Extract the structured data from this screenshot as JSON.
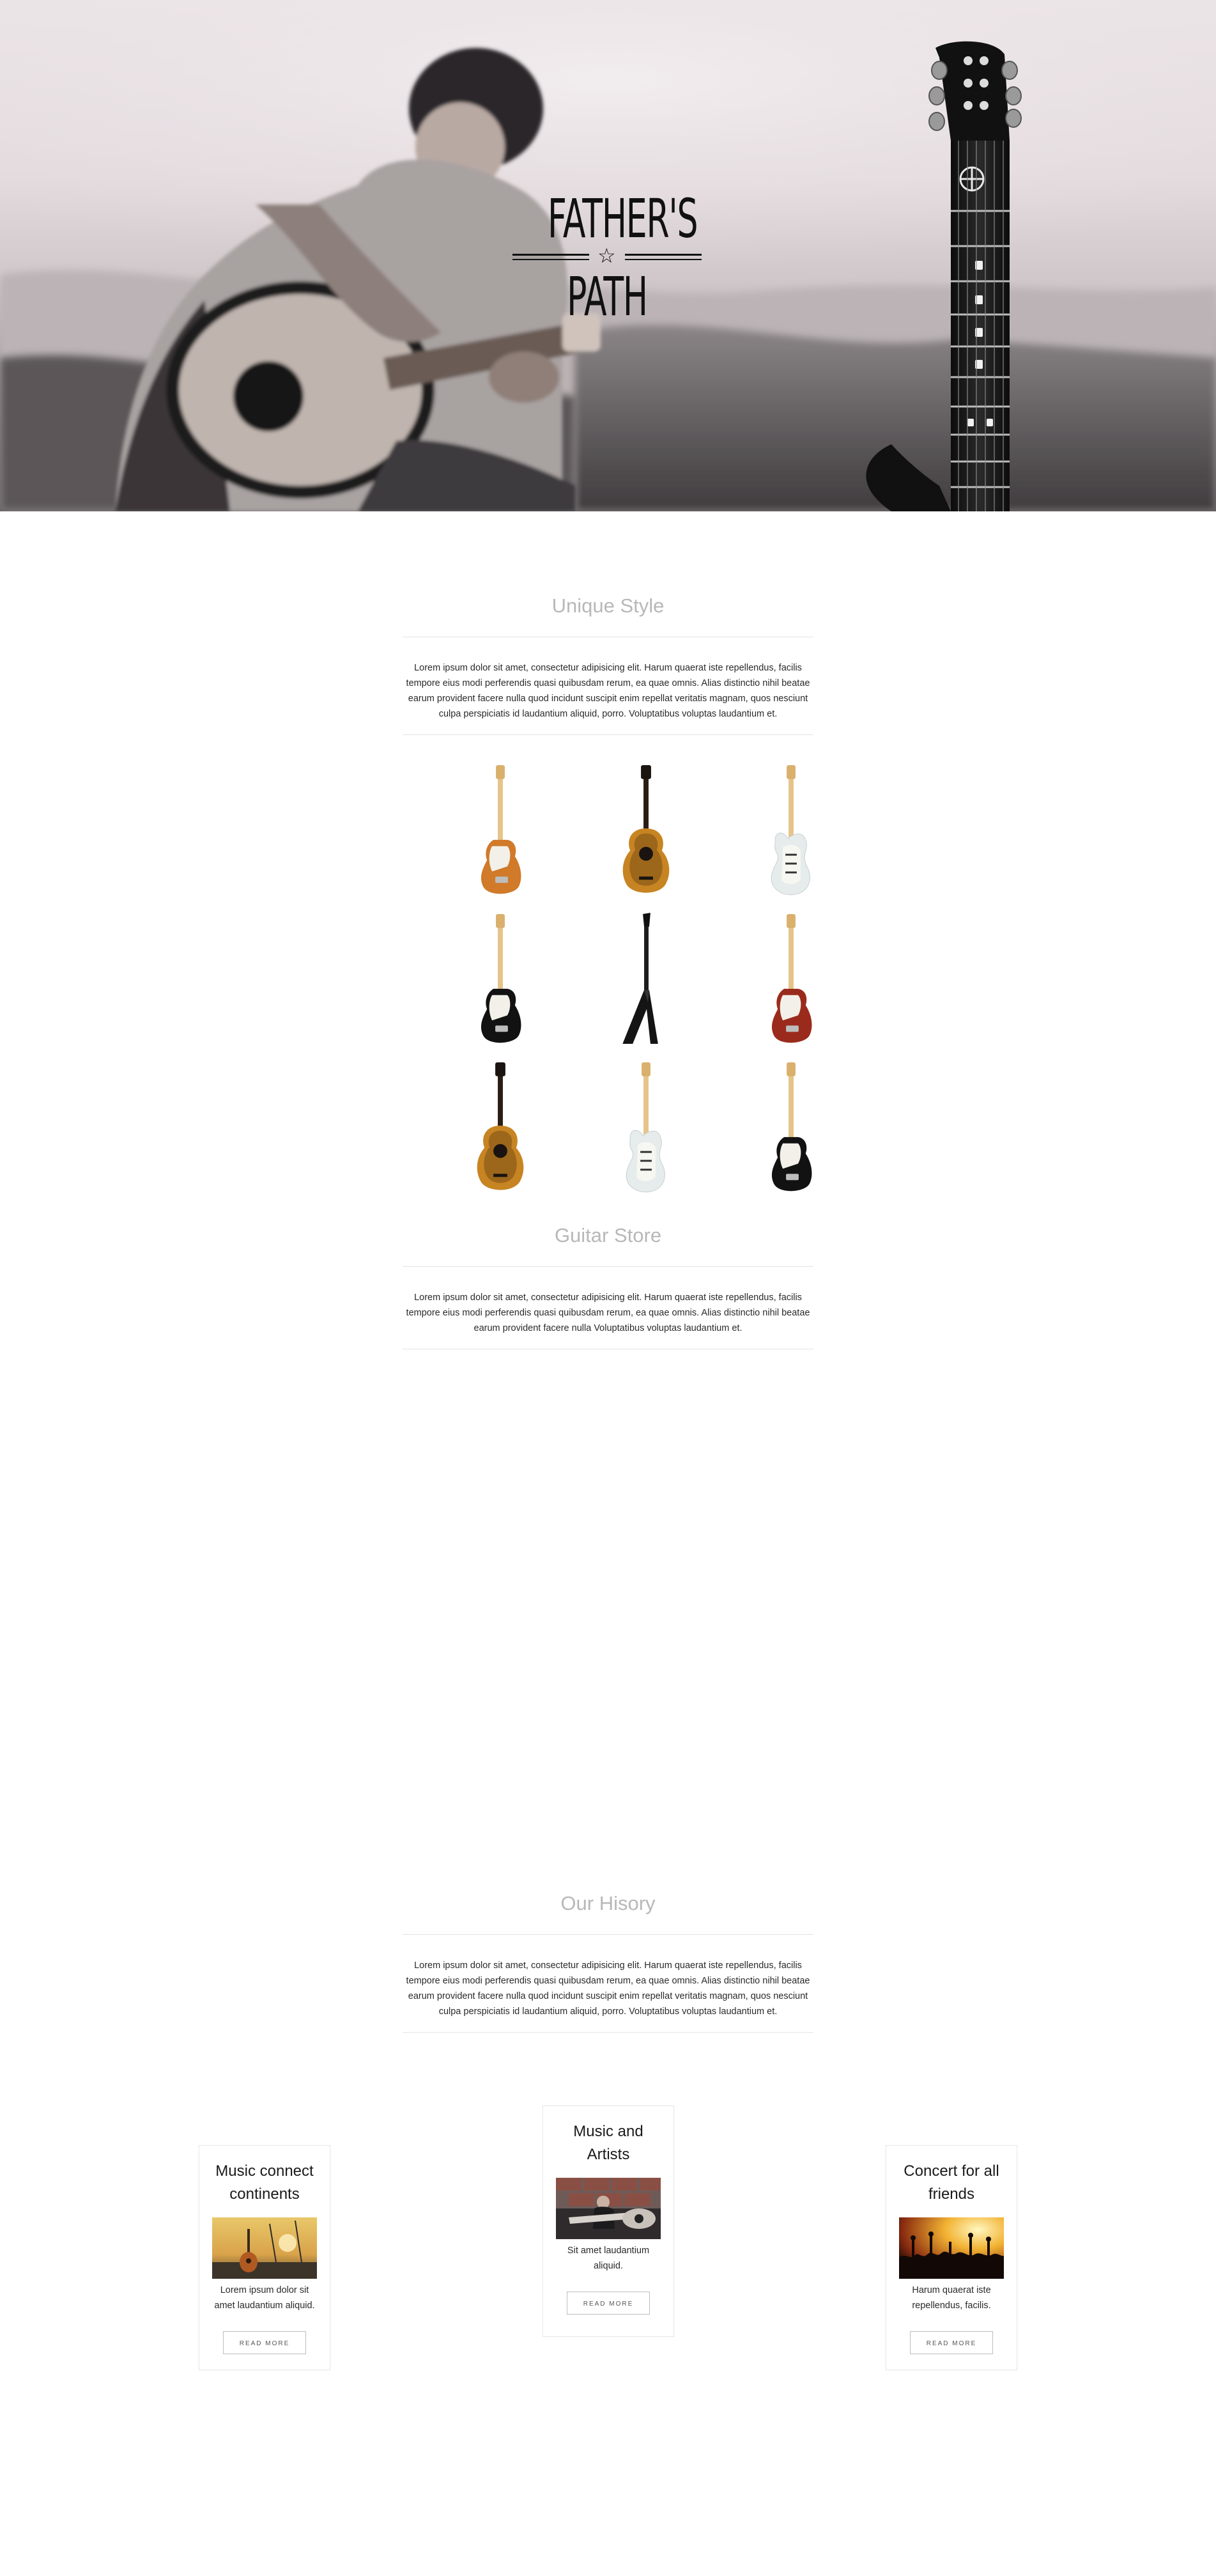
{
  "hero": {
    "logo_top": "FATHER'S",
    "logo_bottom": "PATH",
    "logo_star": "☆"
  },
  "unique": {
    "title": "Unique Style",
    "text": "Lorem ipsum dolor sit amet, consectetur adipisicing elit. Harum quaerat iste repellendus, facilis tempore eius modi perferendis quasi quibusdam rerum, ea quae omnis. Alias distinctio nihil beatae earum provident facere nulla quod incidunt suscipit enim repellat veritatis magnam, quos nesciunt culpa perspiciatis id laudantium aliquid, porro. Voluptatibus voluptas laudantium et."
  },
  "guitars": [
    {
      "kind": "tele",
      "body": "#d07a2a",
      "pick": "#f2f0e8"
    },
    {
      "kind": "acoustic",
      "body": "#c78422",
      "pick": "#1a1a1a"
    },
    {
      "kind": "strat",
      "body": "#e6ecec",
      "pick": "#f7f7f2"
    },
    {
      "kind": "tele",
      "body": "#121212",
      "pick": "#f2f0e8"
    },
    {
      "kind": "flying-v",
      "body": "#141414",
      "pick": "#141414"
    },
    {
      "kind": "tele",
      "body": "#9a2b1c",
      "pick": "#f2f0e8"
    },
    {
      "kind": "acoustic",
      "body": "#c78422",
      "pick": "#1a1a1a"
    },
    {
      "kind": "strat",
      "body": "#e6ecec",
      "pick": "#f7f7f2"
    },
    {
      "kind": "tele",
      "body": "#121212",
      "pick": "#f2f0e8"
    }
  ],
  "store": {
    "title": "Guitar Store",
    "text": "Lorem ipsum dolor sit amet, consectetur adipisicing elit. Harum quaerat iste repellendus, facilis tempore eius modi perferendis quasi quibusdam rerum, ea quae omnis. Alias distinctio nihil beatae earum provident facere nulla Voluptatibus voluptas laudantium et."
  },
  "history": {
    "title": "Our Hisory",
    "text": "Lorem ipsum dolor sit amet, consectetur adipisicing elit. Harum quaerat iste repellendus, facilis tempore eius modi perferendis quasi quibusdam rerum, ea quae omnis. Alias distinctio nihil beatae earum provident facere nulla quod incidunt suscipit enim repellat veritatis magnam, quos nesciunt culpa perspiciatis id laudantium aliquid, porro. Voluptatibus voluptas laudantium et."
  },
  "cards": [
    {
      "title": "Music connect continents",
      "text": "Lorem ipsum dolor sit amet laudantium aliquid.",
      "button": "READ MORE"
    },
    {
      "title": "Music and Artists",
      "text": "Sit amet laudantium aliquid.",
      "button": "READ MORE"
    },
    {
      "title": "Concert for all friends",
      "text": "Harum quaerat iste repellendus, facilis.",
      "button": "READ MORE"
    }
  ]
}
